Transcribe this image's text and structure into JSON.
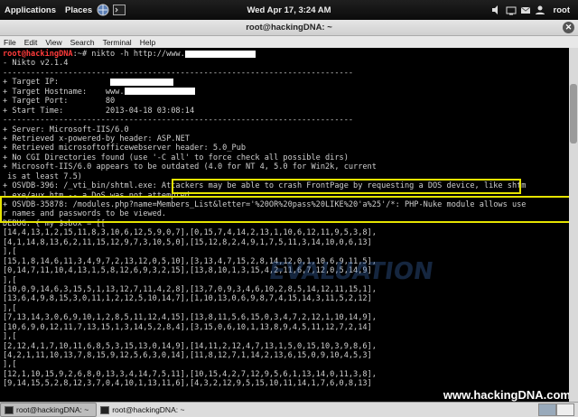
{
  "top_panel": {
    "applications": "Applications",
    "places": "Places",
    "clock": "Wed Apr 17,  3:24 AM",
    "user": "root",
    "icons": [
      "browser-icon",
      "volume-icon",
      "network-icon",
      "mail-icon"
    ]
  },
  "window": {
    "title": "root@hackingDNA: ~",
    "menus": [
      "File",
      "Edit",
      "View",
      "Search",
      "Terminal",
      "Help"
    ]
  },
  "terminal": {
    "prompt_user": "root@hackingDNA",
    "prompt_rest": ":~# nikto -h http://www.",
    "lines": [
      "- Nikto v2.1.4",
      "---------------------------------------------------------------------------",
      "+ Target IP:",
      "+ Target Hostname:    www.",
      "+ Target Port:        80",
      "+ Start Time:         2013-04-18 03:08:14",
      "---------------------------------------------------------------------------",
      "+ Server: Microsoft-IIS/6.0",
      "+ Retrieved x-powered-by header: ASP.NET",
      "+ Retrieved microsoftofficewebserver header: 5.0_Pub",
      "+ No CGI Directories found (use '-C all' to force check all possible dirs)",
      "+ Microsoft-IIS/6.0 appears to be outdated (4.0 for NT 4, 5.0 for Win2k, current",
      " is at least 7.5)",
      "+ OSVDB-396: /_vti_bin/shtml.exe: Attackers may be able to crash FrontPage by requesting a DOS device, like shtm",
      "l.exe/aux.htm -- a DoS was not attempted.",
      "+ OSVDB-35878: /modules.php?name=Members_List&letter='%20OR%20pass%20LIKE%20'a%25'/*: PHP-Nuke module allows use",
      "r names and passwords to be viewed.",
      "DEBUG: { my $sbox = [[",
      "[14,4,13,1,2,15,11,8,3,10,6,12,5,9,0,7],[0,15,7,4,14,2,13,1,10,6,12,11,9,5,3,8],",
      "[4,1,14,8,13,6,2,11,15,12,9,7,3,10,5,0],[15,12,8,2,4,9,1,7,5,11,3,14,10,0,6,13]",
      "],[",
      "[15,1,8,14,6,11,3,4,9,7,2,13,12,0,5,10],[3,13,4,7,15,2,8,14,12,0,1,10,6,9,11,5],",
      "[0,14,7,11,10,4,13,1,5,8,12,6,9,3,2,15],[13,8,10,1,3,15,4,2,11,6,7,12,0,5,14,9]",
      "],[",
      "[10,0,9,14,6,3,15,5,1,13,12,7,11,4,2,8],[13,7,0,9,3,4,6,10,2,8,5,14,12,11,15,1],",
      "[13,6,4,9,8,15,3,0,11,1,2,12,5,10,14,7],[1,10,13,0,6,9,8,7,4,15,14,3,11,5,2,12]",
      "],[",
      "[7,13,14,3,0,6,9,10,1,2,8,5,11,12,4,15],[13,8,11,5,6,15,0,3,4,7,2,12,1,10,14,9],",
      "[10,6,9,0,12,11,7,13,15,1,3,14,5,2,8,4],[3,15,0,6,10,1,13,8,9,4,5,11,12,7,2,14]",
      "],[",
      "[2,12,4,1,7,10,11,6,8,5,3,15,13,0,14,9],[14,11,2,12,4,7,13,1,5,0,15,10,3,9,8,6],",
      "[4,2,1,11,10,13,7,8,15,9,12,5,6,3,0,14],[11,8,12,7,1,14,2,13,6,15,0,9,10,4,5,3]",
      "],[",
      "[12,1,10,15,9,2,6,8,0,13,3,4,14,7,5,11],[10,15,4,2,7,12,9,5,6,1,13,14,0,11,3,8],",
      "[9,14,15,5,2,8,12,3,7,0,4,10,1,13,11,6],[4,3,2,12,9,5,15,10,11,14,1,7,6,0,8,13]"
    ]
  },
  "watermark": "EVALUATION",
  "site_label": "www.hackingDNA.com",
  "taskbar": {
    "tasks": [
      "root@hackingDNA: ~",
      "root@hackingDNA: ~"
    ]
  },
  "colors": {
    "highlight": "#e5e300",
    "prompt": "#ff3b3b",
    "terminal_bg": "#000000",
    "terminal_fg": "#cfcfcf"
  }
}
